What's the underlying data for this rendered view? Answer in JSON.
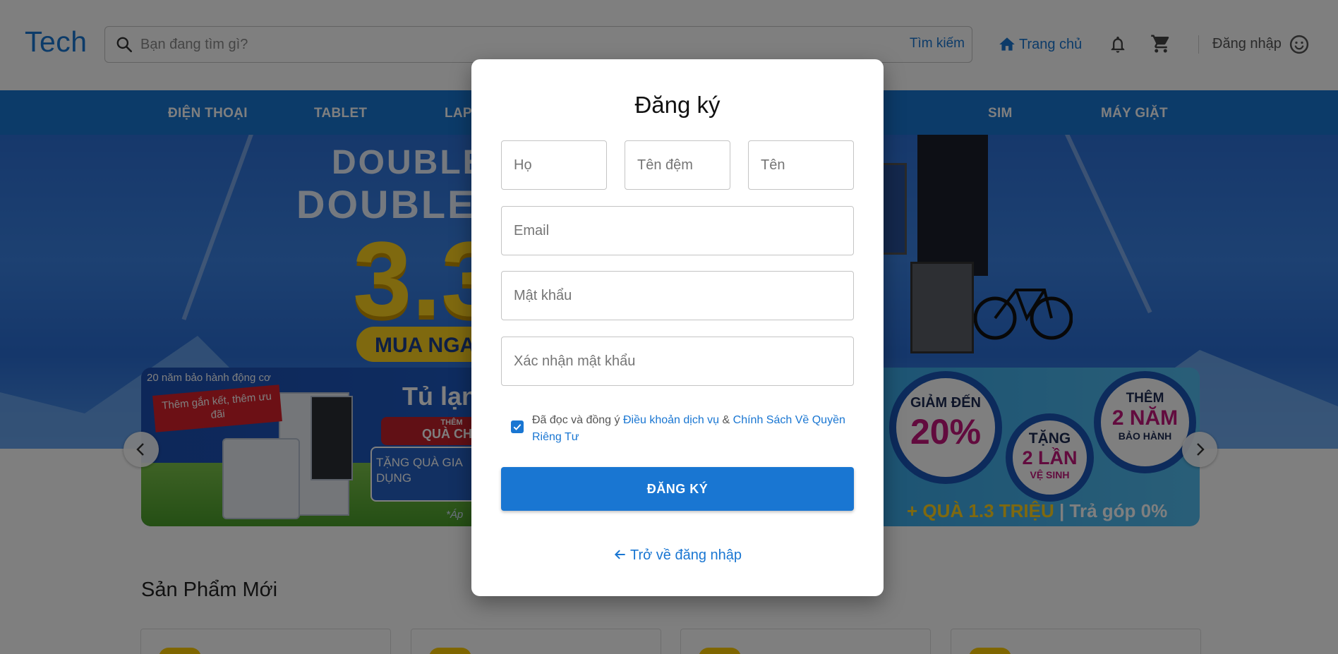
{
  "header": {
    "logo": "Tech",
    "search_placeholder": "Bạn đang tìm gì?",
    "search_button": "Tìm kiếm",
    "home_label": "Trang chủ",
    "login_label": "Đăng nhập",
    "accent_color": "#1976d2"
  },
  "categories": [
    "ĐIỆN THOẠI",
    "TABLET",
    "LAP",
    "SIM",
    "MÁY GIẶT"
  ],
  "hero": {
    "line1": "DOUBLE",
    "line2": "DOUBLE",
    "big": "3.3",
    "cta": "MUA NGA"
  },
  "promo": {
    "warranty": "20 năm bảo hành động cơ",
    "ribbon": "Thêm gắn kết, thêm ưu đãi",
    "fridge": "Tủ lạn",
    "gift_small": "THÊM",
    "gift": "QUÀ CHẤ",
    "home_gift": "TẶNG QUÀ GIA DỤNG",
    "note": "*Áp",
    "badge1_l1": "GIẢM ĐẾN",
    "badge1_l2": "20%",
    "badge2_l1": "TẶNG",
    "badge2_l2": "2 LẦN",
    "badge2_l3": "VỆ SINH",
    "badge3_l1": "THÊM",
    "badge3_l2": "2 NĂM",
    "badge3_l3": "BẢO HÀNH",
    "bottom_gift": "+ QUÀ 1.3 TRIỆU",
    "bottom_install": "| Trả góp 0%"
  },
  "section": {
    "title": "Sản Phẩm Mới"
  },
  "modal": {
    "title": "Đăng ký",
    "first_name_placeholder": "Họ",
    "middle_name_placeholder": "Tên đệm",
    "last_name_placeholder": "Tên",
    "email_placeholder": "Email",
    "password_placeholder": "Mật khẩu",
    "confirm_placeholder": "Xác nhận mật khẩu",
    "terms_prefix": "Đã đọc và đồng ý",
    "terms_link": "Điều khoản dịch vụ",
    "terms_and": "&",
    "privacy_link": "Chính Sách Về Quyền Riêng Tư",
    "checkbox_checked": true,
    "submit_label": "ĐĂNG KÝ",
    "back_label": "Trở về đăng nhập"
  }
}
